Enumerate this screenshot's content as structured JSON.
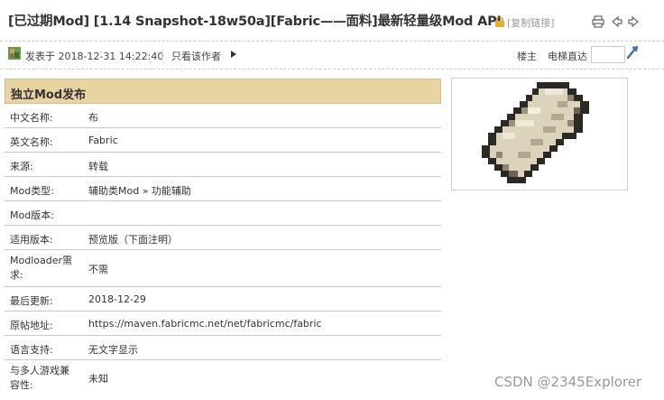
{
  "header": {
    "title": "[已过期Mod] [1.14 Snapshot-18w50a][Fabric——面料]最新轻量级Mod API",
    "copy_link": "[复制链接]",
    "tool_icons": [
      "print-icon",
      "prev-thread-icon",
      "next-thread-icon"
    ]
  },
  "meta": {
    "post_time": "发表于 2018-12-31 14:22:40",
    "separator": "|",
    "author_only": "只看该作者",
    "floor": "楼主",
    "jump_label": "电梯直达",
    "jump_value": ""
  },
  "infobox": {
    "heading": "独立Mod发布",
    "rows": [
      {
        "k": "中文名称:",
        "v": "布"
      },
      {
        "k": "英文名称:",
        "v": "Fabric"
      },
      {
        "k": "来源:",
        "v": "转载"
      },
      {
        "k": "Mod类型:",
        "v": "辅助类Mod » 功能辅助"
      },
      {
        "k": "Mod版本:",
        "v": ""
      },
      {
        "k": "适用版本:",
        "v": "预览版（下面注明）"
      },
      {
        "k": "Modloader需求:",
        "v": "不需"
      },
      {
        "k": "最后更新:",
        "v": "2018-12-29"
      },
      {
        "k": "原帖地址:",
        "v": "https://maven.fabricmc.net/net/fabricmc/fabric"
      },
      {
        "k": "语言支持:",
        "v": "无文字显示"
      },
      {
        "k": "与多人游戏兼容性:",
        "v": "未知"
      }
    ]
  },
  "watermark": "CSDN @2345Explorer",
  "colors": {
    "header_bg": "#e8d3a2",
    "accent_icon": "#3a6fb0"
  }
}
